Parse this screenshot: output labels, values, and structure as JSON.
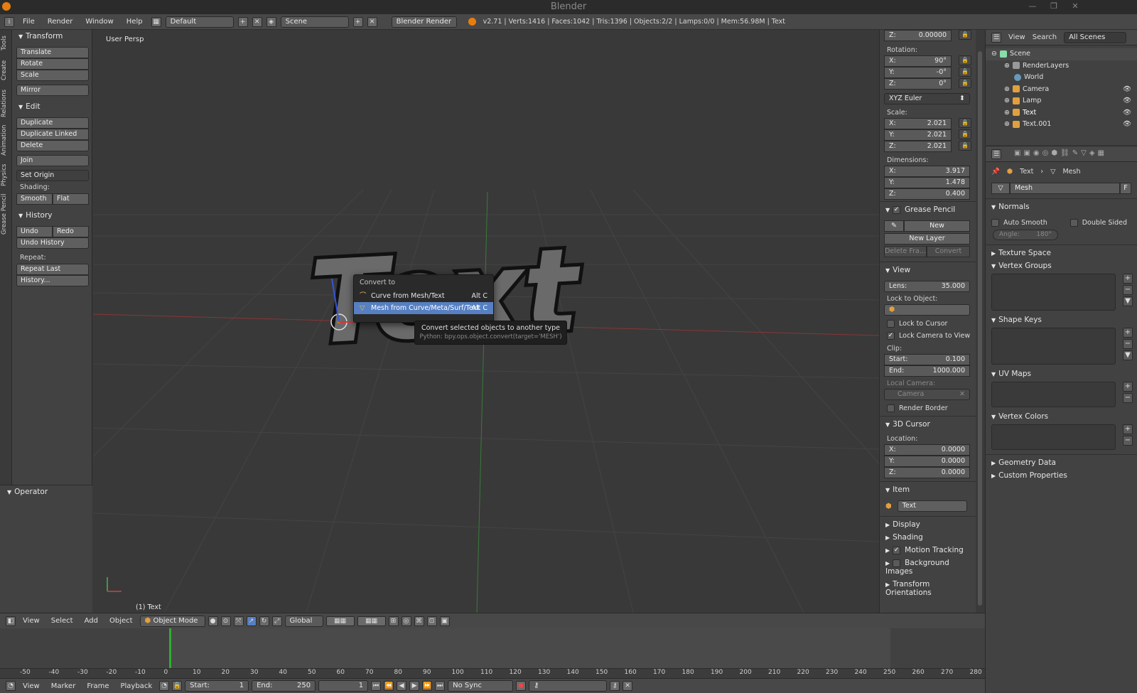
{
  "title": "Blender",
  "infobar": {
    "menus": [
      "File",
      "Render",
      "Window",
      "Help"
    ],
    "layout": "Default",
    "scene": "Scene",
    "engine": "Blender Render",
    "stats": "v2.71 | Verts:1416 | Faces:1042 | Tris:1396 | Objects:2/2 | Lamps:0/0 | Mem:56.98M | Text"
  },
  "tool_tabs": [
    "Tools",
    "Create",
    "Relations",
    "Animation",
    "Physics",
    "Grease Pencil"
  ],
  "toolshelf": {
    "transform": {
      "title": "Transform",
      "buttons": [
        "Translate",
        "Rotate",
        "Scale"
      ],
      "mirror": "Mirror"
    },
    "edit": {
      "title": "Edit",
      "buttons": [
        "Duplicate",
        "Duplicate Linked",
        "Delete"
      ],
      "join": "Join",
      "set_origin": "Set Origin",
      "shading_label": "Shading:",
      "smooth": "Smooth",
      "flat": "Flat"
    },
    "history": {
      "title": "History",
      "undo": "Undo",
      "redo": "Redo",
      "undo_history": "Undo History",
      "repeat_label": "Repeat:",
      "repeat_last": "Repeat Last",
      "history_btn": "History..."
    },
    "operator": "Operator"
  },
  "viewport": {
    "label": "User Persp",
    "object_label": "(1) Text",
    "scene_text": "Text",
    "popup": {
      "title": "Convert to",
      "items": [
        {
          "label": "Curve from Mesh/Text",
          "shortcut": "Alt C"
        },
        {
          "label": "Mesh from Curve/Meta/Surf/Text",
          "shortcut": "Alt C"
        }
      ]
    },
    "tooltip": {
      "line1": "Convert selected objects to another type",
      "line2": "Python: bpy.ops.object.convert(target='MESH')"
    }
  },
  "npanel": {
    "loc_z": {
      "k": "Z:",
      "v": "0.00000"
    },
    "rotation_label": "Rotation:",
    "rotation": [
      {
        "k": "X:",
        "v": "90°"
      },
      {
        "k": "Y:",
        "v": "-0°"
      },
      {
        "k": "Z:",
        "v": "0°"
      }
    ],
    "rot_mode": "XYZ Euler",
    "scale_label": "Scale:",
    "scale": [
      {
        "k": "X:",
        "v": "2.021"
      },
      {
        "k": "Y:",
        "v": "2.021"
      },
      {
        "k": "Z:",
        "v": "2.021"
      }
    ],
    "dimensions_label": "Dimensions:",
    "dimensions": [
      {
        "k": "X:",
        "v": "3.917"
      },
      {
        "k": "Y:",
        "v": "1.478"
      },
      {
        "k": "Z:",
        "v": "0.400"
      }
    ],
    "grease_pencil": {
      "title": "Grease Pencil",
      "new": "New",
      "new_layer": "New Layer",
      "delete_frame": "Delete Fra...",
      "convert": "Convert"
    },
    "view": {
      "title": "View",
      "lens_k": "Lens:",
      "lens_v": "35.000",
      "lock_to_object": "Lock to Object:",
      "lock_to_cursor": "Lock to Cursor",
      "lock_camera": "Lock Camera to View",
      "clip_label": "Clip:",
      "start_k": "Start:",
      "start_v": "0.100",
      "end_k": "End:",
      "end_v": "1000.000",
      "local_camera": "Local Camera:",
      "camera": "Camera",
      "render_border": "Render Border"
    },
    "cursor": {
      "title": "3D Cursor",
      "location_label": "Location:",
      "loc": [
        {
          "k": "X:",
          "v": "0.0000"
        },
        {
          "k": "Y:",
          "v": "0.0000"
        },
        {
          "k": "Z:",
          "v": "0.0000"
        }
      ]
    },
    "item": {
      "title": "Item",
      "name": "Text"
    },
    "collapsed": [
      "Display",
      "Shading",
      "Motion Tracking",
      "Background Images",
      "Transform Orientations"
    ]
  },
  "outliner": {
    "menus": [
      "View",
      "Search"
    ],
    "filter": "All Scenes",
    "rows": [
      "Scene",
      "RenderLayers",
      "World",
      "Camera",
      "Lamp",
      "Text",
      "Text.001"
    ]
  },
  "properties": {
    "breadcrumb": [
      "Text",
      "Mesh"
    ],
    "datablock": "Mesh",
    "fake_user": "F",
    "normals": {
      "title": "Normals",
      "auto_smooth": "Auto Smooth",
      "double_sided": "Double Sided",
      "angle": "Angle:",
      "angle_v": "180°"
    },
    "sections": [
      "Texture Space",
      "Vertex Groups",
      "Shape Keys",
      "UV Maps",
      "Vertex Colors",
      "Geometry Data",
      "Custom Properties"
    ]
  },
  "view3d_header": {
    "menus": [
      "View",
      "Select",
      "Add",
      "Object"
    ],
    "mode": "Object Mode",
    "orientation": "Global"
  },
  "timeline": {
    "ticks": [
      "-50",
      "-40",
      "-30",
      "-20",
      "-10",
      "0",
      "10",
      "20",
      "30",
      "40",
      "50",
      "60",
      "70",
      "80",
      "90",
      "100",
      "110",
      "120",
      "130",
      "140",
      "150",
      "160",
      "170",
      "180",
      "190",
      "200",
      "210",
      "220",
      "230",
      "240",
      "250",
      "260",
      "270",
      "280"
    ],
    "menus": [
      "View",
      "Marker",
      "Frame",
      "Playback"
    ],
    "start_k": "Start:",
    "start_v": "1",
    "end_k": "End:",
    "end_v": "250",
    "current": "1",
    "sync": "No Sync"
  },
  "colors": {
    "selection": "#5680c2",
    "accent_orange": "#e87d0d",
    "x_axis": "#b33",
    "y_axis": "#3a3"
  }
}
